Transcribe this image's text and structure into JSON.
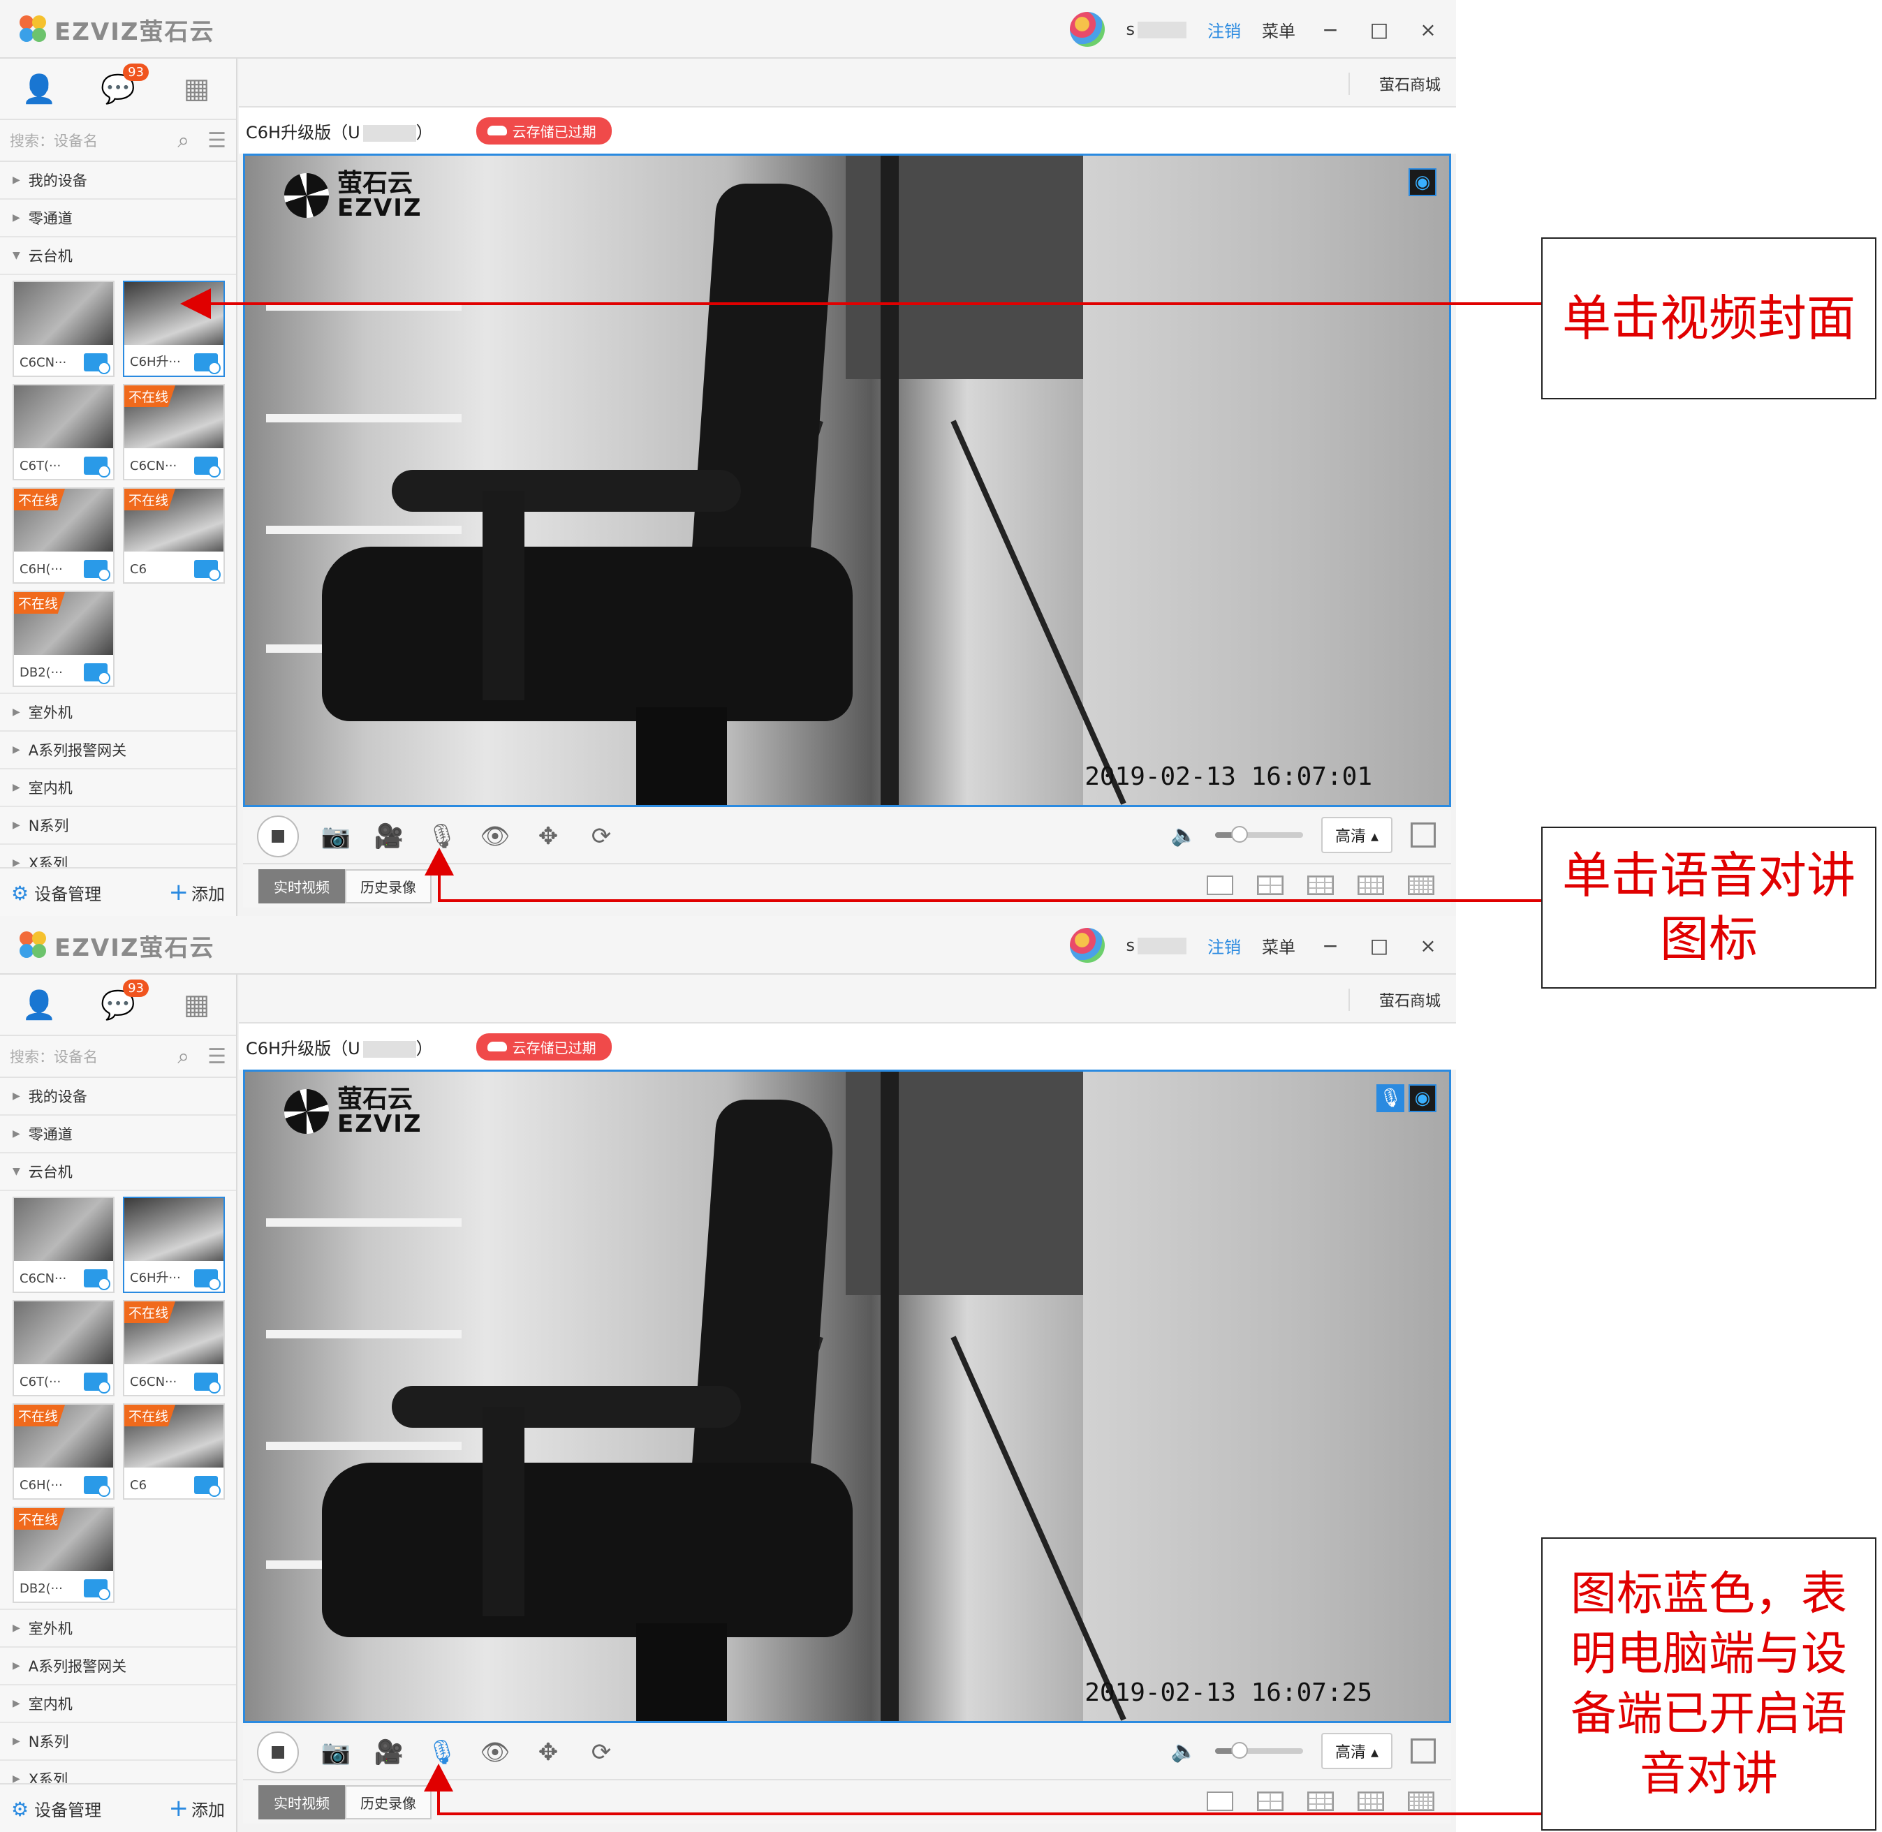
{
  "app": {
    "logo_text": "EZVIZ萤石云",
    "username_prefix": "s",
    "logout_label": "注销",
    "menu_label": "菜单",
    "minimize_label": "−",
    "maximize_label": "□",
    "close_label": "×"
  },
  "sidebar": {
    "message_badge": "93",
    "search_placeholder": "搜索：设备名",
    "groups_top": [
      "我的设备",
      "零通道",
      "云台机"
    ],
    "groups_bottom": [
      "室外机",
      "A系列报警网关",
      "室内机",
      "N系列",
      "X系列"
    ],
    "offline_label": "不在线",
    "devices": [
      {
        "name": "C6CN···",
        "offline": false
      },
      {
        "name": "C6H升···",
        "offline": false
      },
      {
        "name": "C6T(···",
        "offline": false
      },
      {
        "name": "C6CN···",
        "offline": true
      },
      {
        "name": "C6H(···",
        "offline": true
      },
      {
        "name": "C6",
        "offline": true
      },
      {
        "name": "DB2(···",
        "offline": true
      }
    ],
    "manage_label": "设备管理",
    "add_label": "添加"
  },
  "main": {
    "mall_label": "萤石商城",
    "device_title_prefix": "C6H升级版（U",
    "device_title_suffix": "）",
    "cloud_badge": "云存储已过期",
    "watermark_cn": "萤石云",
    "watermark_en": "EZVIZ",
    "quality_label": "高清",
    "tab_live": "实时视频",
    "tab_history": "历史录像",
    "volume_level": 0.28
  },
  "screens": [
    {
      "timestamp": "2019-02-13  16:07:01",
      "mic_active": false,
      "selected_tile": 1
    },
    {
      "timestamp": "2019-02-13  16:07:25",
      "mic_active": true,
      "selected_tile": 1
    }
  ],
  "callouts": {
    "click_cover": "单击视频封面",
    "click_mic": "单击语音对讲图标",
    "mic_blue": "图标蓝色，表明电脑端与设备端已开启语音对讲"
  },
  "colors": {
    "accent": "#2a8ae0",
    "offline": "#f06a1c",
    "cloud_badge": "#f04a4a",
    "annotation": "#e00000"
  },
  "icons": {
    "user_tab": "user-icon",
    "messages_tab": "chat-icon",
    "apps_tab": "grid-icon",
    "search": "search-icon",
    "list": "list-icon",
    "stop": "stop-icon",
    "snapshot": "camera-icon",
    "record": "video-record-icon",
    "talk": "microphone-icon",
    "privacy": "eye-icon",
    "ptz": "ptz-icon",
    "flip": "rotate-icon",
    "volume": "speaker-icon",
    "fullscreen": "fullscreen-icon"
  }
}
